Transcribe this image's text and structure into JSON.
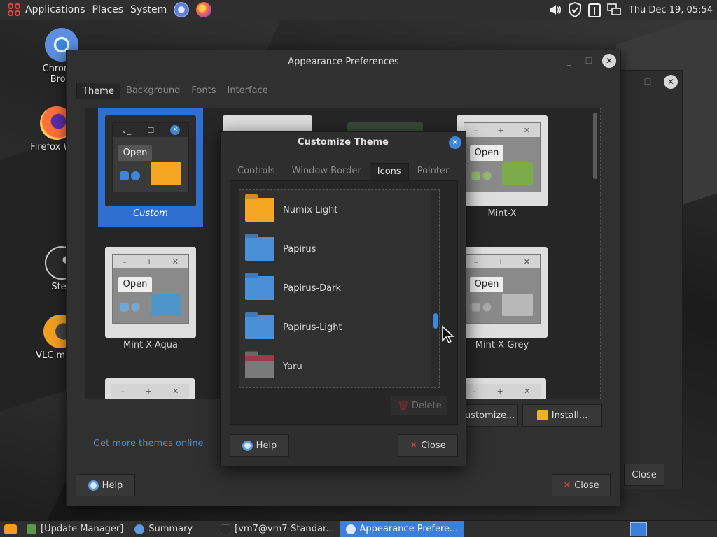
{
  "top_panel": {
    "menus": [
      "Applications",
      "Places",
      "System"
    ],
    "clock": "Thu Dec 19, 05:54"
  },
  "desktop_icons": [
    {
      "label": "Chromium Web Browser",
      "visible_text": "Chromiu\nBrow",
      "icon": "chromium-icon"
    },
    {
      "label": "Firefox Web",
      "visible_text": "Firefox Web",
      "icon": "firefox-icon"
    },
    {
      "label": "Steam",
      "visible_text": "Stea",
      "icon": "steam-icon"
    },
    {
      "label": "VLC media",
      "visible_text": "VLC media",
      "icon": "vlc-icon"
    }
  ],
  "main_window": {
    "title": "Appearance Preferences",
    "tabs": [
      "Theme",
      "Background",
      "Fonts",
      "Interface"
    ],
    "active_tab": "Theme",
    "themes": [
      {
        "name": "Custom",
        "selected": true
      },
      {
        "name": "Mint-X",
        "selected": false
      },
      {
        "name": "Mint-X-Aqua",
        "selected": false
      },
      {
        "name": "Mint-X-Grey",
        "selected": false
      }
    ],
    "mini_open_label": "Open",
    "customize_label": "ustomize...",
    "install_label": "Install...",
    "more_themes_link": "Get more themes online",
    "help_label": "Help",
    "close_label": "Close"
  },
  "bg_window": {
    "close_label": "Close"
  },
  "dialog": {
    "title": "Customize Theme",
    "tabs": [
      "Controls",
      "Window Border",
      "Icons",
      "Pointer"
    ],
    "active_tab": "Icons",
    "icon_themes": [
      {
        "name": "Numix Light",
        "color": "#f5a623"
      },
      {
        "name": "Papirus",
        "color": "#4a90d9"
      },
      {
        "name": "Papirus-Dark",
        "color": "#4a90d9"
      },
      {
        "name": "Papirus-Light",
        "color": "#4a90d9"
      },
      {
        "name": "Yaru",
        "color": "#7a7a7a"
      }
    ],
    "delete_label": "Delete",
    "help_label": "Help",
    "close_label": "Close"
  },
  "taskbar": {
    "tasks": [
      {
        "label": "[Update Manager]",
        "active": false
      },
      {
        "label": "Summary",
        "active": false
      },
      {
        "label": "[vm7@vm7-Standar...",
        "active": false
      },
      {
        "label": "Appearance Prefere...",
        "active": true
      }
    ]
  },
  "colors": {
    "accent": "#2f6fd0",
    "close_red": "#e0443b",
    "link": "#4a8fd8"
  }
}
